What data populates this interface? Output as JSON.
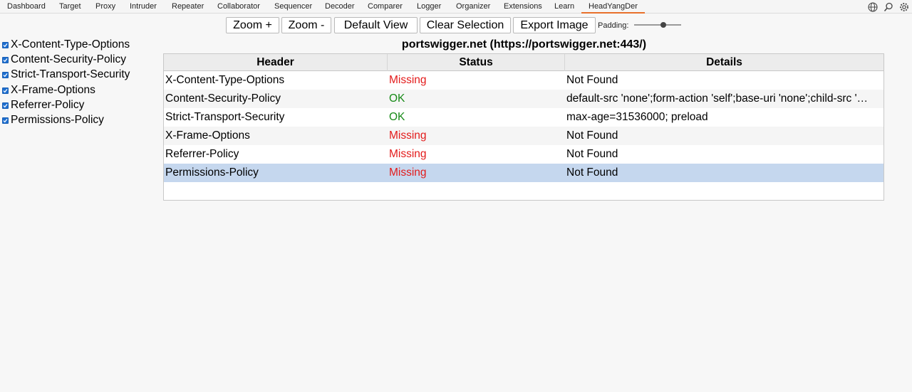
{
  "tabs": [
    {
      "label": "Dashboard"
    },
    {
      "label": "Target"
    },
    {
      "label": "Proxy"
    },
    {
      "label": "Intruder"
    },
    {
      "label": "Repeater"
    },
    {
      "label": "Collaborator"
    },
    {
      "label": "Sequencer"
    },
    {
      "label": "Decoder"
    },
    {
      "label": "Comparer"
    },
    {
      "label": "Logger"
    },
    {
      "label": "Organizer"
    },
    {
      "label": "Extensions"
    },
    {
      "label": "Learn"
    },
    {
      "label": "HeadYangDer",
      "active": true
    }
  ],
  "top_icons": [
    "globe-icon",
    "search-icon",
    "settings-icon"
  ],
  "toolbar": {
    "zoom_in": "Zoom +",
    "zoom_out": "Zoom -",
    "default_view": "Default View",
    "clear_selection": "Clear Selection",
    "export_image": "Export Image",
    "padding_label": "Padding:",
    "padding_value": 0.62
  },
  "filters": [
    {
      "label": "X-Content-Type-Options",
      "checked": true
    },
    {
      "label": "Content-Security-Policy",
      "checked": true
    },
    {
      "label": "Strict-Transport-Security",
      "checked": true
    },
    {
      "label": "X-Frame-Options",
      "checked": true
    },
    {
      "label": "Referrer-Policy",
      "checked": true
    },
    {
      "label": "Permissions-Policy",
      "checked": true
    }
  ],
  "site_title": "portswigger.net (https://portswigger.net:443/)",
  "table": {
    "columns": [
      "Header",
      "Status",
      "Details"
    ],
    "rows": [
      {
        "header": "X-Content-Type-Options",
        "status": "Missing",
        "details": "Not Found"
      },
      {
        "header": "Content-Security-Policy",
        "status": "OK",
        "details": "default-src 'none';form-action 'self';base-uri 'none';child-src '…"
      },
      {
        "header": "Strict-Transport-Security",
        "status": "OK",
        "details": "max-age=31536000; preload"
      },
      {
        "header": "X-Frame-Options",
        "status": "Missing",
        "details": "Not Found"
      },
      {
        "header": "Referrer-Policy",
        "status": "Missing",
        "details": "Not Found"
      },
      {
        "header": "Permissions-Policy",
        "status": "Missing",
        "details": "Not Found",
        "selected": true
      }
    ]
  },
  "colors": {
    "missing": "#e31b1b",
    "ok": "#178a17",
    "selection": "#c5d7ee",
    "active_tab_underline": "#e8702a",
    "checkbox": "#1e6fd0"
  }
}
